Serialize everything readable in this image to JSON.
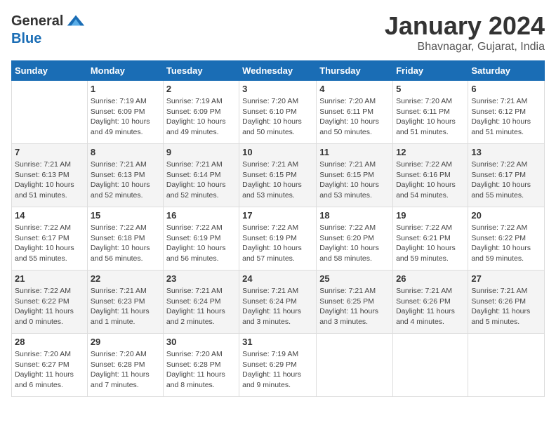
{
  "header": {
    "logo_general": "General",
    "logo_blue": "Blue",
    "title": "January 2024",
    "subtitle": "Bhavnagar, Gujarat, India"
  },
  "days_of_week": [
    "Sunday",
    "Monday",
    "Tuesday",
    "Wednesday",
    "Thursday",
    "Friday",
    "Saturday"
  ],
  "weeks": [
    [
      {
        "day": "",
        "info": ""
      },
      {
        "day": "1",
        "info": "Sunrise: 7:19 AM\nSunset: 6:09 PM\nDaylight: 10 hours and 49 minutes."
      },
      {
        "day": "2",
        "info": "Sunrise: 7:19 AM\nSunset: 6:09 PM\nDaylight: 10 hours and 49 minutes."
      },
      {
        "day": "3",
        "info": "Sunrise: 7:20 AM\nSunset: 6:10 PM\nDaylight: 10 hours and 50 minutes."
      },
      {
        "day": "4",
        "info": "Sunrise: 7:20 AM\nSunset: 6:11 PM\nDaylight: 10 hours and 50 minutes."
      },
      {
        "day": "5",
        "info": "Sunrise: 7:20 AM\nSunset: 6:11 PM\nDaylight: 10 hours and 51 minutes."
      },
      {
        "day": "6",
        "info": "Sunrise: 7:21 AM\nSunset: 6:12 PM\nDaylight: 10 hours and 51 minutes."
      }
    ],
    [
      {
        "day": "7",
        "info": "Sunrise: 7:21 AM\nSunset: 6:13 PM\nDaylight: 10 hours and 51 minutes."
      },
      {
        "day": "8",
        "info": "Sunrise: 7:21 AM\nSunset: 6:13 PM\nDaylight: 10 hours and 52 minutes."
      },
      {
        "day": "9",
        "info": "Sunrise: 7:21 AM\nSunset: 6:14 PM\nDaylight: 10 hours and 52 minutes."
      },
      {
        "day": "10",
        "info": "Sunrise: 7:21 AM\nSunset: 6:15 PM\nDaylight: 10 hours and 53 minutes."
      },
      {
        "day": "11",
        "info": "Sunrise: 7:21 AM\nSunset: 6:15 PM\nDaylight: 10 hours and 53 minutes."
      },
      {
        "day": "12",
        "info": "Sunrise: 7:22 AM\nSunset: 6:16 PM\nDaylight: 10 hours and 54 minutes."
      },
      {
        "day": "13",
        "info": "Sunrise: 7:22 AM\nSunset: 6:17 PM\nDaylight: 10 hours and 55 minutes."
      }
    ],
    [
      {
        "day": "14",
        "info": "Sunrise: 7:22 AM\nSunset: 6:17 PM\nDaylight: 10 hours and 55 minutes."
      },
      {
        "day": "15",
        "info": "Sunrise: 7:22 AM\nSunset: 6:18 PM\nDaylight: 10 hours and 56 minutes."
      },
      {
        "day": "16",
        "info": "Sunrise: 7:22 AM\nSunset: 6:19 PM\nDaylight: 10 hours and 56 minutes."
      },
      {
        "day": "17",
        "info": "Sunrise: 7:22 AM\nSunset: 6:19 PM\nDaylight: 10 hours and 57 minutes."
      },
      {
        "day": "18",
        "info": "Sunrise: 7:22 AM\nSunset: 6:20 PM\nDaylight: 10 hours and 58 minutes."
      },
      {
        "day": "19",
        "info": "Sunrise: 7:22 AM\nSunset: 6:21 PM\nDaylight: 10 hours and 59 minutes."
      },
      {
        "day": "20",
        "info": "Sunrise: 7:22 AM\nSunset: 6:22 PM\nDaylight: 10 hours and 59 minutes."
      }
    ],
    [
      {
        "day": "21",
        "info": "Sunrise: 7:22 AM\nSunset: 6:22 PM\nDaylight: 11 hours and 0 minutes."
      },
      {
        "day": "22",
        "info": "Sunrise: 7:21 AM\nSunset: 6:23 PM\nDaylight: 11 hours and 1 minute."
      },
      {
        "day": "23",
        "info": "Sunrise: 7:21 AM\nSunset: 6:24 PM\nDaylight: 11 hours and 2 minutes."
      },
      {
        "day": "24",
        "info": "Sunrise: 7:21 AM\nSunset: 6:24 PM\nDaylight: 11 hours and 3 minutes."
      },
      {
        "day": "25",
        "info": "Sunrise: 7:21 AM\nSunset: 6:25 PM\nDaylight: 11 hours and 3 minutes."
      },
      {
        "day": "26",
        "info": "Sunrise: 7:21 AM\nSunset: 6:26 PM\nDaylight: 11 hours and 4 minutes."
      },
      {
        "day": "27",
        "info": "Sunrise: 7:21 AM\nSunset: 6:26 PM\nDaylight: 11 hours and 5 minutes."
      }
    ],
    [
      {
        "day": "28",
        "info": "Sunrise: 7:20 AM\nSunset: 6:27 PM\nDaylight: 11 hours and 6 minutes."
      },
      {
        "day": "29",
        "info": "Sunrise: 7:20 AM\nSunset: 6:28 PM\nDaylight: 11 hours and 7 minutes."
      },
      {
        "day": "30",
        "info": "Sunrise: 7:20 AM\nSunset: 6:28 PM\nDaylight: 11 hours and 8 minutes."
      },
      {
        "day": "31",
        "info": "Sunrise: 7:19 AM\nSunset: 6:29 PM\nDaylight: 11 hours and 9 minutes."
      },
      {
        "day": "",
        "info": ""
      },
      {
        "day": "",
        "info": ""
      },
      {
        "day": "",
        "info": ""
      }
    ]
  ]
}
